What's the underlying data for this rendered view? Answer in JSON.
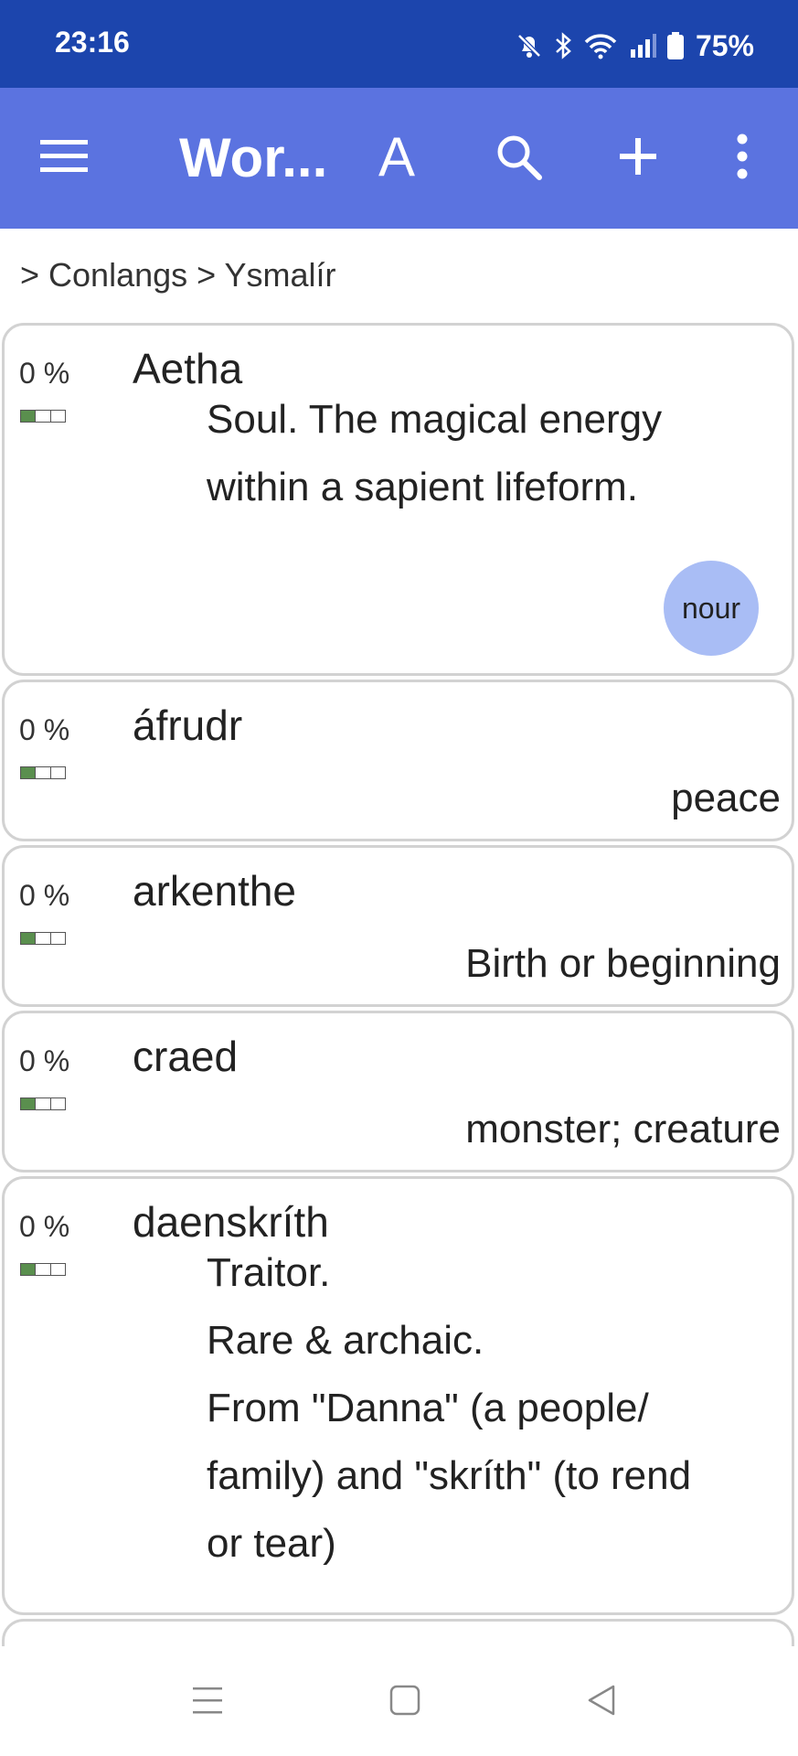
{
  "status_bar": {
    "time": "23:16",
    "battery": "75%",
    "icons": [
      "bell-muted-icon",
      "bluetooth-icon",
      "wifi-icon",
      "signal-icon",
      "battery-icon"
    ]
  },
  "app_bar": {
    "title": "Wor...",
    "font_label": "A",
    "icons": [
      "hamburger-menu-icon",
      "search-icon",
      "plus-icon",
      "more-vertical-icon"
    ]
  },
  "breadcrumb": "> Conlangs > Ysmalír",
  "colors": {
    "status_bar": "#1c45ad",
    "app_bar": "#5b73e0",
    "tag_bg": "#a9bdf5",
    "progress_fill": "#5a8f4e"
  },
  "entries": [
    {
      "percent": "0 %",
      "progress": 0.33,
      "word": "Aetha",
      "definition_lines": [
        "Soul. The magical energy",
        "within a sapient lifeform."
      ],
      "tag": "nour"
    },
    {
      "percent": "0 %",
      "progress": 0.33,
      "word": "áfrudr",
      "definition_lines": [
        "peace"
      ]
    },
    {
      "percent": "0 %",
      "progress": 0.33,
      "word": "arkenthe",
      "definition_lines": [
        "Birth or beginning"
      ]
    },
    {
      "percent": "0 %",
      "progress": 0.33,
      "word": "craed",
      "definition_lines": [
        "monster; creature"
      ]
    },
    {
      "percent": "0 %",
      "progress": 0.33,
      "word": "daenskríth",
      "definition_lines": [
        "Traitor.",
        "Rare & archaic.",
        "From \"Danna\" (a people/",
        "family) and \"skríth\" (to rend",
        "or tear)"
      ]
    }
  ],
  "nav_bar": {
    "icons": [
      "recents-icon",
      "home-icon",
      "back-icon"
    ]
  }
}
